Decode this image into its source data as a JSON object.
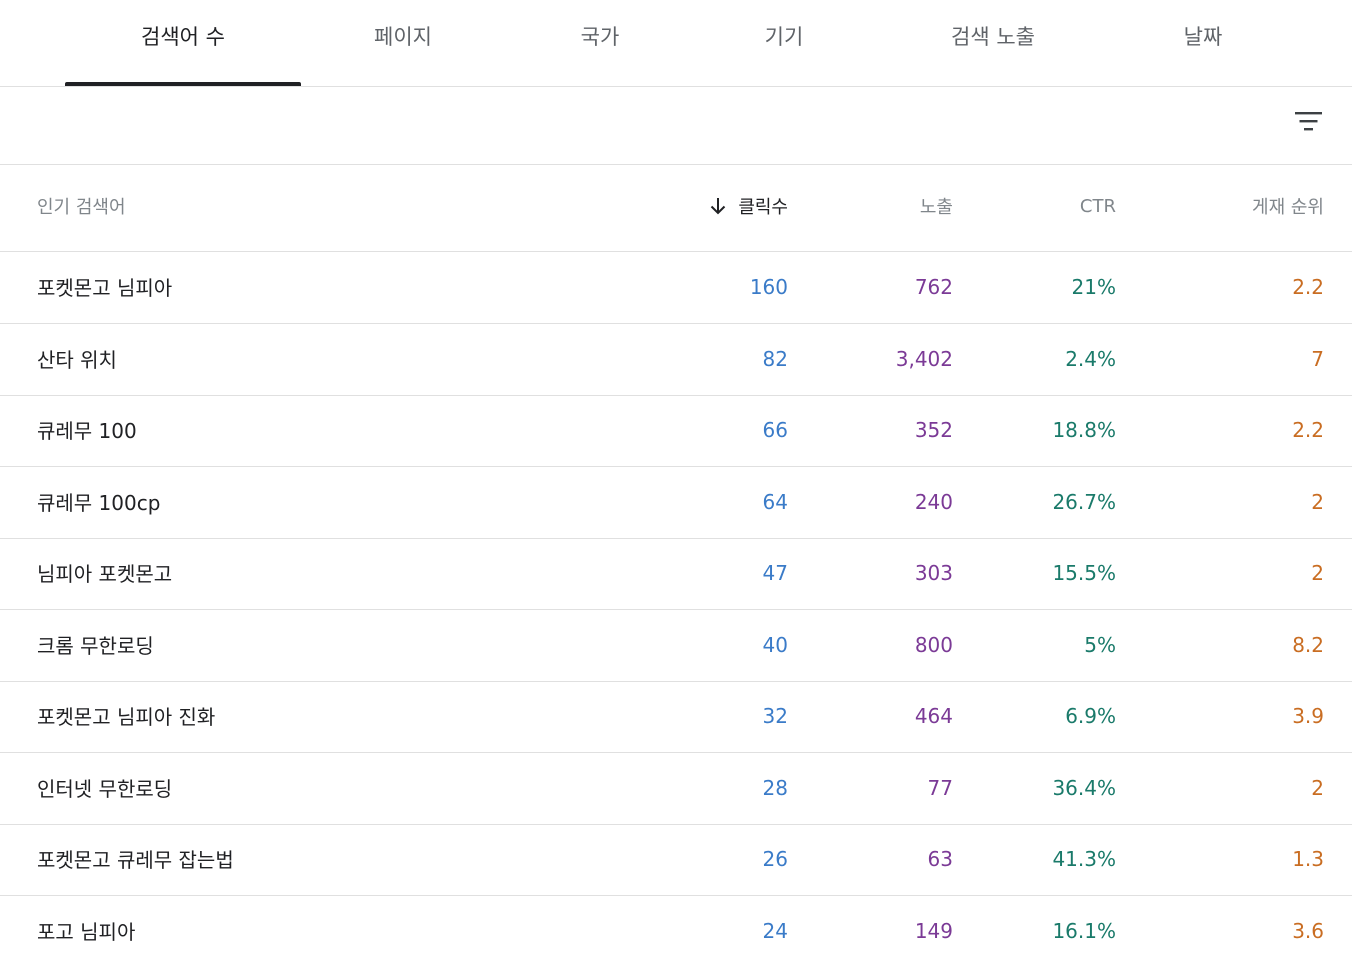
{
  "tabs": [
    {
      "label": "검색어 수",
      "active": true
    },
    {
      "label": "페이지",
      "active": false
    },
    {
      "label": "국가",
      "active": false
    },
    {
      "label": "기기",
      "active": false
    },
    {
      "label": "검색 노출",
      "active": false
    },
    {
      "label": "날짜",
      "active": false
    }
  ],
  "toolbar": {
    "filter_icon": "filter-list-icon"
  },
  "table": {
    "headers": {
      "query": "인기 검색어",
      "clicks": "클릭수",
      "impressions": "노출",
      "ctr": "CTR",
      "position": "게재 순위"
    },
    "sort_icon": "arrow-down-icon",
    "rows": [
      {
        "query": "포켓몬고 님피아",
        "clicks": "160",
        "impressions": "762",
        "ctr": "21%",
        "position": "2.2"
      },
      {
        "query": "산타 위치",
        "clicks": "82",
        "impressions": "3,402",
        "ctr": "2.4%",
        "position": "7"
      },
      {
        "query": "큐레무 100",
        "clicks": "66",
        "impressions": "352",
        "ctr": "18.8%",
        "position": "2.2"
      },
      {
        "query": "큐레무 100cp",
        "clicks": "64",
        "impressions": "240",
        "ctr": "26.7%",
        "position": "2"
      },
      {
        "query": "님피아 포켓몬고",
        "clicks": "47",
        "impressions": "303",
        "ctr": "15.5%",
        "position": "2"
      },
      {
        "query": "크롬 무한로딩",
        "clicks": "40",
        "impressions": "800",
        "ctr": "5%",
        "position": "8.2"
      },
      {
        "query": "포켓몬고 님피아 진화",
        "clicks": "32",
        "impressions": "464",
        "ctr": "6.9%",
        "position": "3.9"
      },
      {
        "query": "인터넷 무한로딩",
        "clicks": "28",
        "impressions": "77",
        "ctr": "36.4%",
        "position": "2"
      },
      {
        "query": "포켓몬고 큐레무 잡는법",
        "clicks": "26",
        "impressions": "63",
        "ctr": "41.3%",
        "position": "1.3"
      },
      {
        "query": "포고 님피아",
        "clicks": "24",
        "impressions": "149",
        "ctr": "16.1%",
        "position": "3.6"
      }
    ]
  },
  "colors": {
    "clicks": "#3a7bc8",
    "impressions": "#7b3a96",
    "ctr": "#1a7a6a",
    "position": "#c96d22"
  }
}
